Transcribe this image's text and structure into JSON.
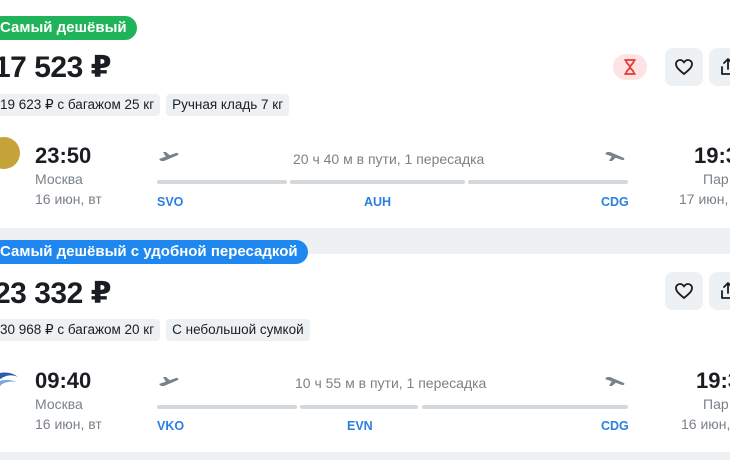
{
  "offers": [
    {
      "badge": "Самый дешёвый",
      "price": "17 523 ₽",
      "tags": [
        "19 623 ₽ с багажом 25 кг",
        "Ручная кладь 7 кг"
      ],
      "departure": {
        "time": "23:50",
        "city": "Москва",
        "date": "16 июн, вт"
      },
      "arrival": {
        "time": "19:3",
        "city": "Пар",
        "date": "17 июн,"
      },
      "duration": "20 ч 40 м в пути, 1 пересадка",
      "airports": [
        "SVO",
        "AUH",
        "CDG"
      ],
      "icons": {
        "fare_alert": "hourglass-icon",
        "favorite": "heart-icon",
        "share": "share-icon"
      }
    },
    {
      "badge": "Самый дешёвый с удобной пересадкой",
      "price": "23 332 ₽",
      "tags": [
        "30 968 ₽ с багажом 20 кг",
        "С небольшой сумкой"
      ],
      "departure": {
        "time": "09:40",
        "city": "Москва",
        "date": "16 июн, вт"
      },
      "arrival": {
        "time": "19:3",
        "city": "Пар",
        "date": "16 июн,"
      },
      "duration": "10 ч 55 м в пути, 1 пересадка",
      "airports": [
        "VKO",
        "EVN",
        "CDG"
      ],
      "icons": {
        "favorite": "heart-icon",
        "share": "share-icon"
      }
    }
  ],
  "colors": {
    "green_badge": "#1fb45a",
    "blue_badge": "#1e88f0",
    "airport_code": "#2a7fe0",
    "muted_text": "#7a8289"
  }
}
